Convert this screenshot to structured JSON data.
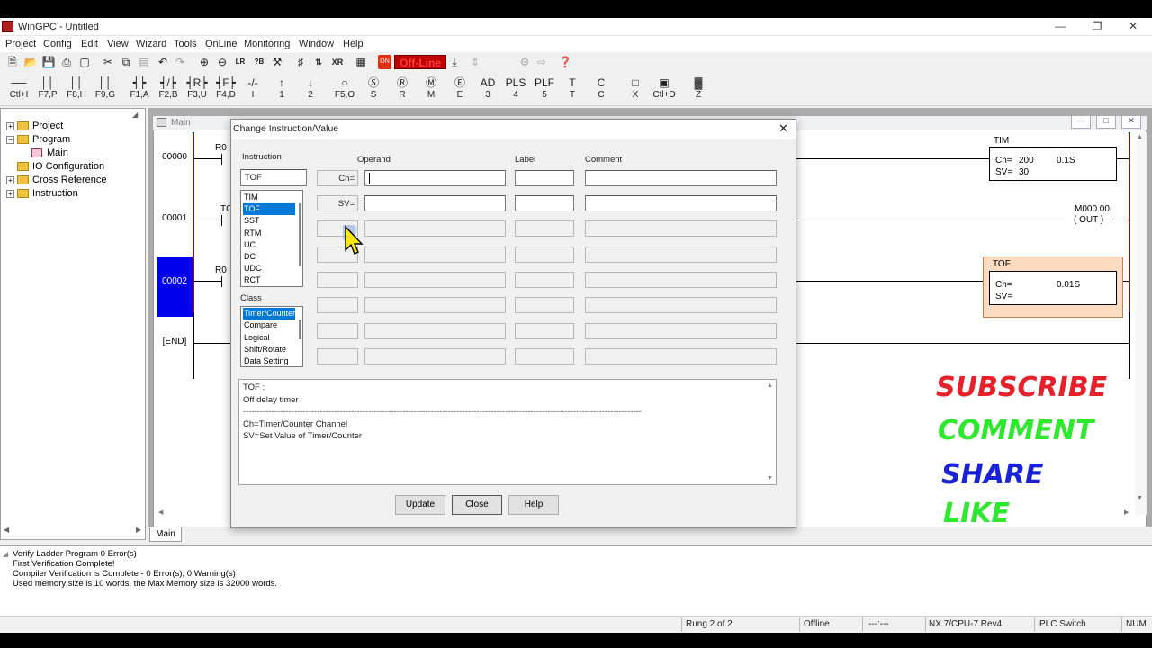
{
  "window": {
    "title": "WinGPC - Untitled"
  },
  "menubar": [
    "Project",
    "Config",
    "Edit",
    "View",
    "Wizard",
    "Tools",
    "OnLine",
    "Monitoring",
    "Window",
    "Help"
  ],
  "toolbar": {
    "status_badge": "Off-Line",
    "on_badge": "ON"
  },
  "ladder_keys": [
    {
      "sym": "──",
      "key": "Ctl+I"
    },
    {
      "sym": "││",
      "key": "F7,P"
    },
    {
      "sym": "││",
      "key": "F8,H"
    },
    {
      "sym": "││",
      "key": "F9,G"
    },
    {
      "sym": "┥┝",
      "key": "F1,A"
    },
    {
      "sym": "┥/┝",
      "key": "F2,B"
    },
    {
      "sym": "┥R┝",
      "key": "F3,U"
    },
    {
      "sym": "┥F┝",
      "key": "F4,D"
    },
    {
      "sym": "-/-",
      "key": "I"
    },
    {
      "sym": "↑",
      "key": "1"
    },
    {
      "sym": "↓",
      "key": "2"
    },
    {
      "sym": "○",
      "key": "F5,O"
    },
    {
      "sym": "Ⓢ",
      "key": "S"
    },
    {
      "sym": "Ⓡ",
      "key": "R"
    },
    {
      "sym": "Ⓜ",
      "key": "M"
    },
    {
      "sym": "Ⓔ",
      "key": "E"
    },
    {
      "sym": "AD",
      "key": "3"
    },
    {
      "sym": "PLS",
      "key": "4"
    },
    {
      "sym": "PLF",
      "key": "5"
    },
    {
      "sym": "T",
      "key": "T"
    },
    {
      "sym": "C",
      "key": "C"
    },
    {
      "sym": "□",
      "key": "X"
    },
    {
      "sym": "▣",
      "key": "Ctl+D"
    },
    {
      "sym": "▓",
      "key": "Z"
    }
  ],
  "tree": {
    "project": "Project",
    "program": "Program",
    "main": "Main",
    "io": "IO Configuration",
    "crossref": "Cross Reference",
    "instruction": "Instruction"
  },
  "ladder": {
    "window_title": "Main",
    "rungs": [
      "00000",
      "00001",
      "00002",
      "[END]"
    ],
    "frag_r0": "R0",
    "frag_tc": "TC",
    "frag_r2": "R0",
    "tim": {
      "name": "TIM",
      "ch_label": "Ch=",
      "ch_value": "200",
      "base": "0.1S",
      "sv_label": "SV=",
      "sv_value": "30"
    },
    "out": {
      "coil": "M000.00",
      "label": "( OUT )"
    },
    "tof": {
      "name": "TOF",
      "ch_label": "Ch=",
      "base": "0.01S",
      "sv_label": "SV="
    },
    "tab": "Main"
  },
  "dialog": {
    "title": "Change Instruction/Value",
    "instruction_label": "Instruction",
    "instruction_value": "TOF",
    "instructions": [
      "TIM",
      "TOF",
      "SST",
      "RTM",
      "UC",
      "DC",
      "UDC",
      "RCT"
    ],
    "selected_instruction": "TOF",
    "class_label": "Class",
    "classes": [
      "Timer/Counter",
      "Compare",
      "Logical",
      "Shift/Rotate",
      "Data Setting"
    ],
    "selected_class": "Timer/Counter",
    "headers": {
      "operand": "Operand",
      "label": "Label",
      "comment": "Comment"
    },
    "row_labels": [
      "Ch=",
      "SV="
    ],
    "desc": {
      "name": "TOF :",
      "summary": "Off delay timer",
      "divider": "--------------------------------------------------------------------------------------------------------------------------------------------",
      "line1": "Ch=Timer/Counter Channel",
      "line2": "SV=Set Value of Timer/Counter"
    },
    "buttons": {
      "update": "Update",
      "close": "Close",
      "help": "Help"
    }
  },
  "promo": {
    "subscribe": "SUBSCRIBE",
    "comment": "COMMENT",
    "share": "SHARE",
    "like": "LIKE",
    "colors": {
      "subscribe": "#e8202a",
      "comment": "#2ee82e",
      "share": "#1822d8",
      "like": "#2ee82e"
    }
  },
  "output": [
    "Verify Ladder Program 0 Error(s)",
    "First Verification Complete!",
    "Compiler Verification is Complete - 0 Error(s), 0 Warning(s)",
    "Used memory size is 10 words, the Max Memory size is 32000 words."
  ],
  "status": {
    "rung": "Rung 2 of 2",
    "mode": "Offline",
    "dashes": "---:---",
    "cpu": "NX 7/CPU-7 Rev4",
    "plc": "PLC Switch",
    "num": "NUM"
  }
}
